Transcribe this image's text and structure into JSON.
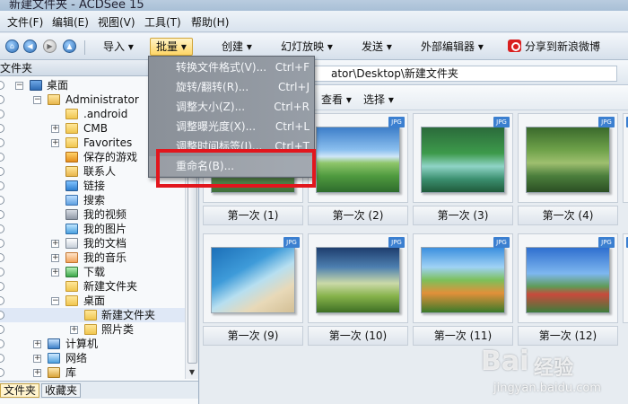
{
  "window": {
    "title": "新建文件夹 - ACDSee 15"
  },
  "menubar": [
    "文件(F)",
    "编辑(E)",
    "视图(V)",
    "工具(T)",
    "帮助(H)"
  ],
  "toolbar": {
    "import": "导入 ▾",
    "batch": "批量 ▾",
    "create": "创建 ▾",
    "slideshow": "幻灯放映 ▾",
    "send": "发送 ▾",
    "external_editor": "外部编辑器 ▾",
    "share_weibo": "分享到新浪微博"
  },
  "left_panel": {
    "header": "文件夹",
    "tree": [
      {
        "label": "桌面",
        "level": 1,
        "icon": "desktop-icon",
        "expander": "−",
        "selected": false
      },
      {
        "label": "Administrator",
        "level": 2,
        "icon": "user-folder-icon",
        "expander": "−",
        "selected": false
      },
      {
        "label": ".android",
        "level": 3,
        "icon": "folder-icon",
        "expander": "",
        "selected": false
      },
      {
        "label": "CMB",
        "level": 3,
        "icon": "folder-icon",
        "expander": "+",
        "selected": false
      },
      {
        "label": "Favorites",
        "level": 3,
        "icon": "folder-icon",
        "expander": "+",
        "selected": false
      },
      {
        "label": "保存的游戏",
        "level": 3,
        "icon": "saved-games-icon",
        "expander": "",
        "selected": false
      },
      {
        "label": "联系人",
        "level": 3,
        "icon": "contacts-icon",
        "expander": "",
        "selected": false
      },
      {
        "label": "链接",
        "level": 3,
        "icon": "links-icon",
        "expander": "",
        "selected": false
      },
      {
        "label": "搜索",
        "level": 3,
        "icon": "search-folder-icon",
        "expander": "",
        "selected": false
      },
      {
        "label": "我的视频",
        "level": 3,
        "icon": "videos-icon",
        "expander": "",
        "selected": false
      },
      {
        "label": "我的图片",
        "level": 3,
        "icon": "pictures-icon",
        "expander": "",
        "selected": false
      },
      {
        "label": "我的文档",
        "level": 3,
        "icon": "documents-icon",
        "expander": "+",
        "selected": false
      },
      {
        "label": "我的音乐",
        "level": 3,
        "icon": "music-icon",
        "expander": "+",
        "selected": false
      },
      {
        "label": "下载",
        "level": 3,
        "icon": "downloads-icon",
        "expander": "+",
        "selected": false
      },
      {
        "label": "新建文件夹",
        "level": 3,
        "icon": "folder-icon",
        "expander": "",
        "selected": false
      },
      {
        "label": "桌面",
        "level": 3,
        "icon": "folder-icon",
        "expander": "−",
        "selected": false
      },
      {
        "label": "新建文件夹",
        "level": 4,
        "icon": "folder-icon",
        "expander": "",
        "selected": true
      },
      {
        "label": "照片类",
        "level": 4,
        "icon": "folder-icon",
        "expander": "+",
        "selected": false
      },
      {
        "label": "计算机",
        "level": 2,
        "icon": "computer-icon",
        "expander": "+",
        "selected": false
      },
      {
        "label": "网络",
        "level": 2,
        "icon": "network-icon",
        "expander": "+",
        "selected": false
      },
      {
        "label": "库",
        "level": 2,
        "icon": "library-icon",
        "expander": "+",
        "selected": false
      }
    ],
    "bottom_tabs": [
      "文件夹",
      "收藏夹"
    ]
  },
  "right_panel": {
    "path": "ator\\Desktop\\新建文件夹",
    "view_menu": "查看 ▾",
    "select_menu": "选择 ▾",
    "thumbnail_badge": "JPG",
    "thumbnails": [
      {
        "caption": "第一次 (1)",
        "style": "p1"
      },
      {
        "caption": "第一次 (2)",
        "style": "p2"
      },
      {
        "caption": "第一次 (3)",
        "style": "p3"
      },
      {
        "caption": "第一次 (4)",
        "style": "p4"
      },
      {
        "caption": "第一次 (9)",
        "style": "p9"
      },
      {
        "caption": "第一次 (10)",
        "style": "p10"
      },
      {
        "caption": "第一次 (11)",
        "style": "p11"
      },
      {
        "caption": "第一次 (12)",
        "style": "p12"
      }
    ]
  },
  "batch_menu": [
    {
      "label": "转换文件格式(V)...",
      "shortcut": "Ctrl+F"
    },
    {
      "label": "旋转/翻转(R)...",
      "shortcut": "Ctrl+J"
    },
    {
      "label": "调整大小(Z)...",
      "shortcut": "Ctrl+R"
    },
    {
      "label": "调整曝光度(X)...",
      "shortcut": "Ctrl+L"
    },
    {
      "label": "调整时间标签(I)...",
      "shortcut": "Ctrl+T"
    },
    {
      "label": "重命名(B)...",
      "shortcut": ""
    }
  ],
  "watermark": {
    "brand": "Bai",
    "brand2": "经验",
    "url": "jingyan.baidu.com"
  }
}
